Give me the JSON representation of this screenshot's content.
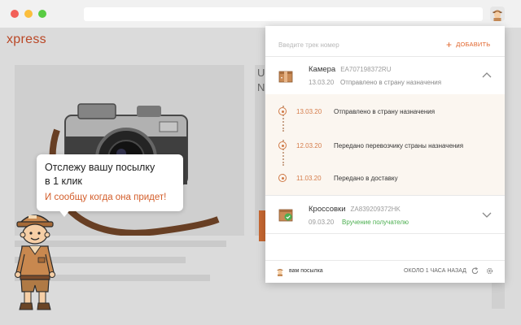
{
  "browser": {
    "window_controls": [
      "close",
      "minimize",
      "maximize"
    ],
    "extension_icon": "courier-icon"
  },
  "page": {
    "brand": "xpress",
    "side_letters": [
      "U",
      "N"
    ]
  },
  "popup": {
    "search": {
      "placeholder": "Введите трек номер",
      "value": ""
    },
    "add_label": "ДОБАВИТЬ",
    "parcels": [
      {
        "name": "Камера",
        "track": "EA707198372RU",
        "date": "13.03.20",
        "status": "Отправлено в страну назначения",
        "status_color": "#888888",
        "icon": "package-box-icon",
        "expanded": true,
        "history": [
          {
            "date": "13.03.20",
            "text": "Отправлено в страну назначения"
          },
          {
            "date": "12.03.20",
            "text": "Передано перевозчику страны назначения"
          },
          {
            "date": "11.03.20",
            "text": "Передано в доставку"
          }
        ]
      },
      {
        "name": "Кроссовки",
        "track": "ZA839209372HK",
        "date": "09.03.20",
        "status": "Вручение получателю",
        "status_color": "#4caf50",
        "icon": "delivered-box-icon",
        "expanded": false
      }
    ],
    "footer": {
      "label": "вам посылка",
      "updated": "ОКОЛО 1 ЧАСА НАЗАД",
      "icons": [
        "refresh-icon",
        "settings-icon"
      ]
    }
  },
  "bubble": {
    "line1": "Отслежу вашу посылку",
    "line2": "в 1 клик",
    "line3": "И сообщу когда она придет!"
  },
  "colors": {
    "accent": "#e1662d",
    "success": "#4caf50",
    "timeline_bg": "#fbf6f0"
  }
}
